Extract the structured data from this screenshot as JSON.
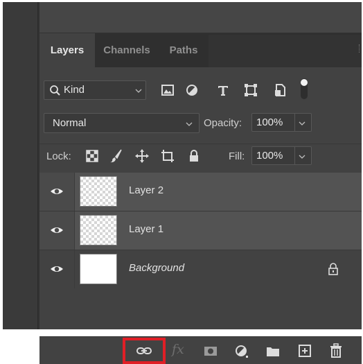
{
  "tabs": [
    {
      "label": "Layers",
      "active": true
    },
    {
      "label": "Channels",
      "active": false
    },
    {
      "label": "Paths",
      "active": false
    }
  ],
  "filter": {
    "kind_label": "Kind",
    "icons": [
      "image-filter-icon",
      "adjustment-filter-icon",
      "type-filter-icon",
      "shape-filter-icon",
      "smart-object-filter-icon",
      "filter-toggle-icon"
    ]
  },
  "blend": {
    "mode": "Normal",
    "opacity_label": "Opacity:",
    "opacity_value": "100%"
  },
  "lock": {
    "label": "Lock:",
    "fill_label": "Fill:",
    "fill_value": "100%",
    "icons": [
      "lock-transparent-pixels-icon",
      "lock-image-pixels-icon",
      "lock-position-icon",
      "lock-artboard-icon",
      "lock-all-icon"
    ]
  },
  "layers": [
    {
      "name": "Layer 2",
      "visible": true,
      "transparent": true,
      "selected": true
    },
    {
      "name": "Layer 1",
      "visible": true,
      "transparent": true,
      "selected": true
    },
    {
      "name": "Background",
      "visible": true,
      "transparent": false,
      "selected": false,
      "locked": true
    }
  ],
  "bottom_bar": {
    "icons": [
      "link-layers-icon",
      "fx-icon",
      "add-mask-icon",
      "adjustment-layer-icon",
      "new-group-icon",
      "new-layer-icon",
      "delete-icon"
    ],
    "fx_label": "fx",
    "highlighted": "link-layers-icon",
    "highlight_color": "#e01f26"
  },
  "colors": {
    "panel_bg": "#424242",
    "selected_row": "#535353",
    "text": "#e2e2e2"
  }
}
